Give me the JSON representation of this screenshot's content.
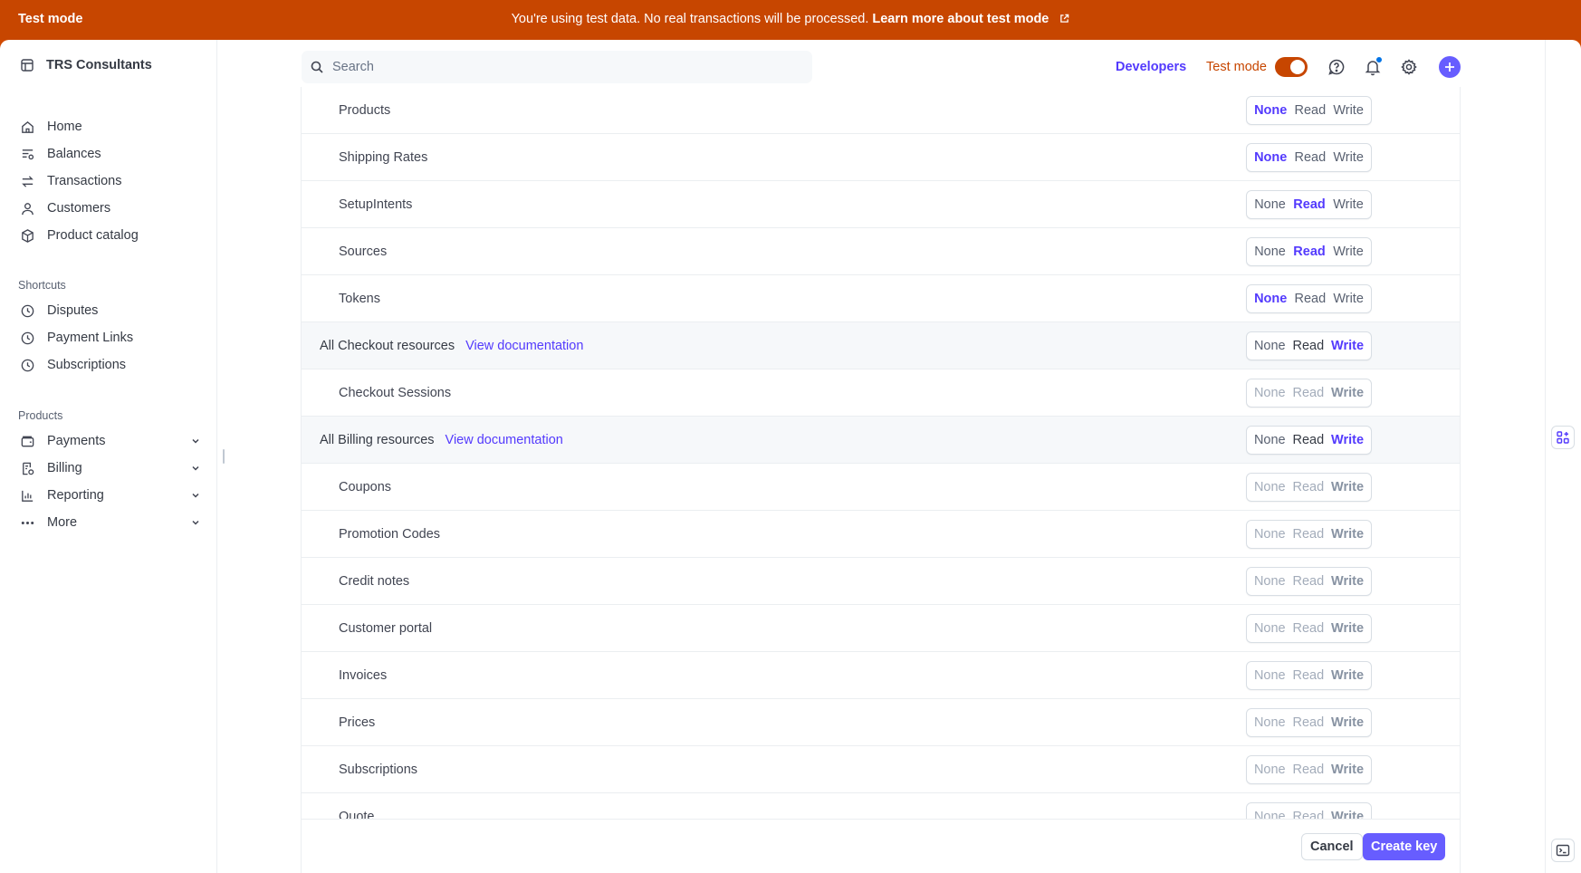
{
  "banner": {
    "mode_label": "Test mode",
    "message": "You're using test data. No real transactions will be processed.",
    "link": "Learn more about test mode"
  },
  "sidebar": {
    "account": "TRS Consultants",
    "main": [
      {
        "label": "Home",
        "icon": "home-icon"
      },
      {
        "label": "Balances",
        "icon": "balances-icon"
      },
      {
        "label": "Transactions",
        "icon": "transactions-icon"
      },
      {
        "label": "Customers",
        "icon": "customers-icon"
      },
      {
        "label": "Product catalog",
        "icon": "product-catalog-icon"
      }
    ],
    "shortcuts_label": "Shortcuts",
    "shortcuts": [
      {
        "label": "Disputes",
        "icon": "clock-icon"
      },
      {
        "label": "Payment Links",
        "icon": "clock-icon"
      },
      {
        "label": "Subscriptions",
        "icon": "clock-icon"
      }
    ],
    "products_label": "Products",
    "products": [
      {
        "label": "Payments",
        "icon": "payments-icon"
      },
      {
        "label": "Billing",
        "icon": "billing-icon"
      },
      {
        "label": "Reporting",
        "icon": "reporting-icon"
      },
      {
        "label": "More",
        "icon": "more-icon"
      }
    ]
  },
  "topbar": {
    "search_placeholder": "Search",
    "developers": "Developers",
    "test_mode": "Test mode",
    "test_mode_on": true
  },
  "permission_options": [
    "None",
    "Read",
    "Write"
  ],
  "permissions": [
    {
      "label": "Products",
      "selected": "None",
      "group": false,
      "disabled": false
    },
    {
      "label": "Shipping Rates",
      "selected": "None",
      "group": false,
      "disabled": false
    },
    {
      "label": "SetupIntents",
      "selected": "Read",
      "group": false,
      "disabled": false
    },
    {
      "label": "Sources",
      "selected": "Read",
      "group": false,
      "disabled": false
    },
    {
      "label": "Tokens",
      "selected": "None",
      "group": false,
      "disabled": false
    },
    {
      "label": "All Checkout resources",
      "doc_link": "View documentation",
      "selected": "Write",
      "group": true,
      "disabled": false
    },
    {
      "label": "Checkout Sessions",
      "selected": "Write",
      "group": false,
      "disabled": true
    },
    {
      "label": "All Billing resources",
      "doc_link": "View documentation",
      "selected": "Write",
      "group": true,
      "disabled": false
    },
    {
      "label": "Coupons",
      "selected": "Write",
      "group": false,
      "disabled": true
    },
    {
      "label": "Promotion Codes",
      "selected": "Write",
      "group": false,
      "disabled": true
    },
    {
      "label": "Credit notes",
      "selected": "Write",
      "group": false,
      "disabled": true
    },
    {
      "label": "Customer portal",
      "selected": "Write",
      "group": false,
      "disabled": true
    },
    {
      "label": "Invoices",
      "selected": "Write",
      "group": false,
      "disabled": true
    },
    {
      "label": "Prices",
      "selected": "Write",
      "group": false,
      "disabled": true
    },
    {
      "label": "Subscriptions",
      "selected": "Write",
      "group": false,
      "disabled": true
    },
    {
      "label": "Quote",
      "selected": "Write",
      "group": false,
      "disabled": true
    }
  ],
  "footer": {
    "cancel": "Cancel",
    "create": "Create key"
  },
  "colors": {
    "banner": "#c74600",
    "accent": "#533afd",
    "primary_button": "#675dff"
  }
}
